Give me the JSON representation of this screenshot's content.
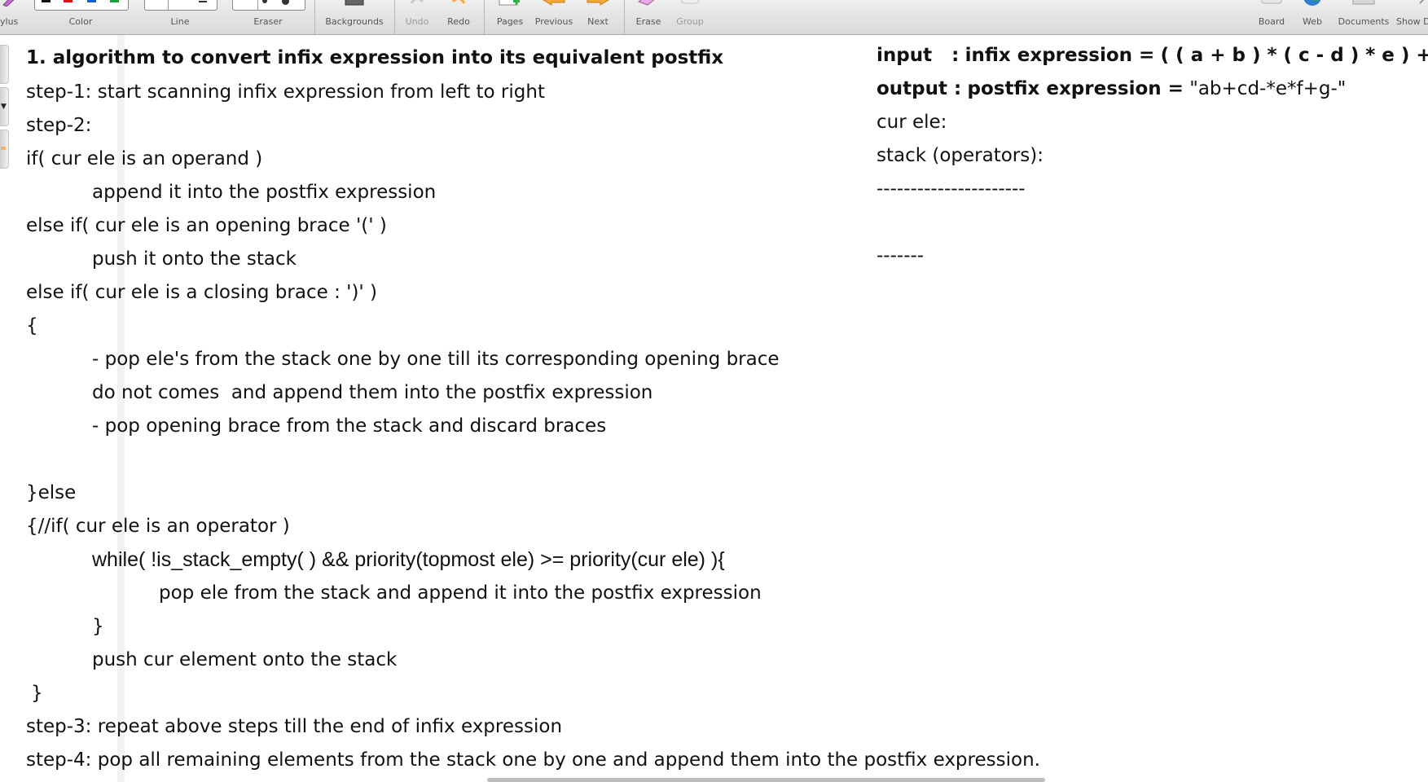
{
  "toolbar": {
    "stylus": "ylus",
    "color": "Color",
    "line": "Line",
    "eraser": "Eraser",
    "backgrounds": "Backgrounds",
    "undo": "Undo",
    "redo": "Redo",
    "pages": "Pages",
    "previous": "Previous",
    "next": "Next",
    "erase": "Erase",
    "group": "Group",
    "board": "Board",
    "web": "Web",
    "documents": "Documents",
    "show": "Show D",
    "colors": [
      "#111111",
      "#e01010",
      "#1a5ad8",
      "#15a03c"
    ]
  },
  "board": {
    "title": "1. algorithm to convert infix expression into its equivalent postfix",
    "lines": [
      "step-1: start scanning infix expression from left to right",
      "step-2:",
      "if( cur ele is an operand )",
      "append it into the postfix expression",
      "else if( cur ele is an opening brace '(' )",
      "push it onto the stack",
      "else if( cur ele is a closing brace : ')' )",
      "{",
      "- pop ele's from the stack one by one till its corresponding opening brace",
      "do not comes  and append them into the postfix expression",
      "- pop opening brace from the stack and discard braces",
      "}else",
      "{//if( cur ele is an operator )",
      "while( !is_stack_empty( ) && priority(topmost ele) >= priority(cur ele) ){",
      "pop ele from the stack and append it into the postfix expression",
      "}",
      "push cur element onto the stack",
      "}",
      "step-3: repeat above steps till the end of infix expression",
      "step-4: pop all remaining elements from the stack one by one and append them into the postfix expression."
    ],
    "input_label": "input   :",
    "input_expr_label": "infix expression =",
    "input_value": "( ( a + b ) * ( c - d ) * e ) + f - g",
    "output_label": "output :",
    "output_expr_label": "postfix expression =",
    "output_value": "\"ab+cd-*e*f+g-\"",
    "cur_ele": "cur ele:",
    "stack": "stack (operators):",
    "dash_long": "----------------------",
    "dash_short": "-------"
  }
}
